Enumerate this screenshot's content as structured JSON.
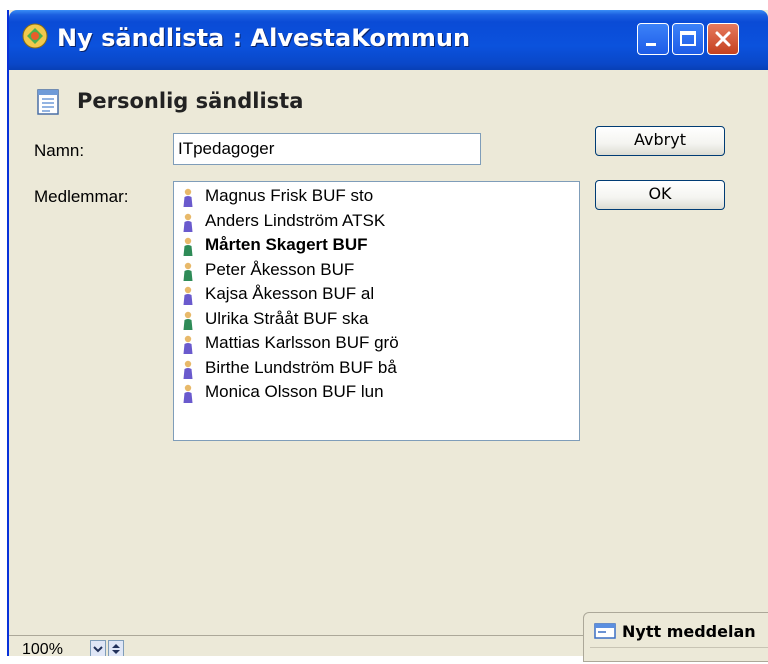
{
  "window": {
    "title": "Ny sändlista : AlvestaKommun"
  },
  "form": {
    "heading": "Personlig sändlista",
    "name_label": "Namn:",
    "name_value": "ITpedagoger",
    "members_label": "Medlemmar:",
    "cancel_label": "Avbryt",
    "ok_label": "OK"
  },
  "members": [
    {
      "name": "Magnus Frisk BUF sto",
      "bold": false,
      "icon_color": "#6a5acd"
    },
    {
      "name": "Anders Lindström ATSK",
      "bold": false,
      "icon_color": "#6a5acd"
    },
    {
      "name": "Mårten Skagert BUF",
      "bold": true,
      "icon_color": "#2e8b57"
    },
    {
      "name": "Peter Åkesson BUF",
      "bold": false,
      "icon_color": "#2e8b57"
    },
    {
      "name": "Kajsa Åkesson BUF al",
      "bold": false,
      "icon_color": "#6a5acd"
    },
    {
      "name": "Ulrika Strååt BUF ska",
      "bold": false,
      "icon_color": "#2e8b57"
    },
    {
      "name": "Mattias Karlsson BUF grö",
      "bold": false,
      "icon_color": "#6a5acd"
    },
    {
      "name": "Birthe Lundström BUF bå",
      "bold": false,
      "icon_color": "#6a5acd"
    },
    {
      "name": "Monica Olsson BUF lun",
      "bold": false,
      "icon_color": "#6a5acd"
    }
  ],
  "footer": {
    "zoom": "100%"
  },
  "taskbar": {
    "label": "Nytt meddelan"
  },
  "colors": {
    "titlebar": "#0a4bd6",
    "window_bg": "#ece9d8",
    "border": "#7f9db9"
  }
}
